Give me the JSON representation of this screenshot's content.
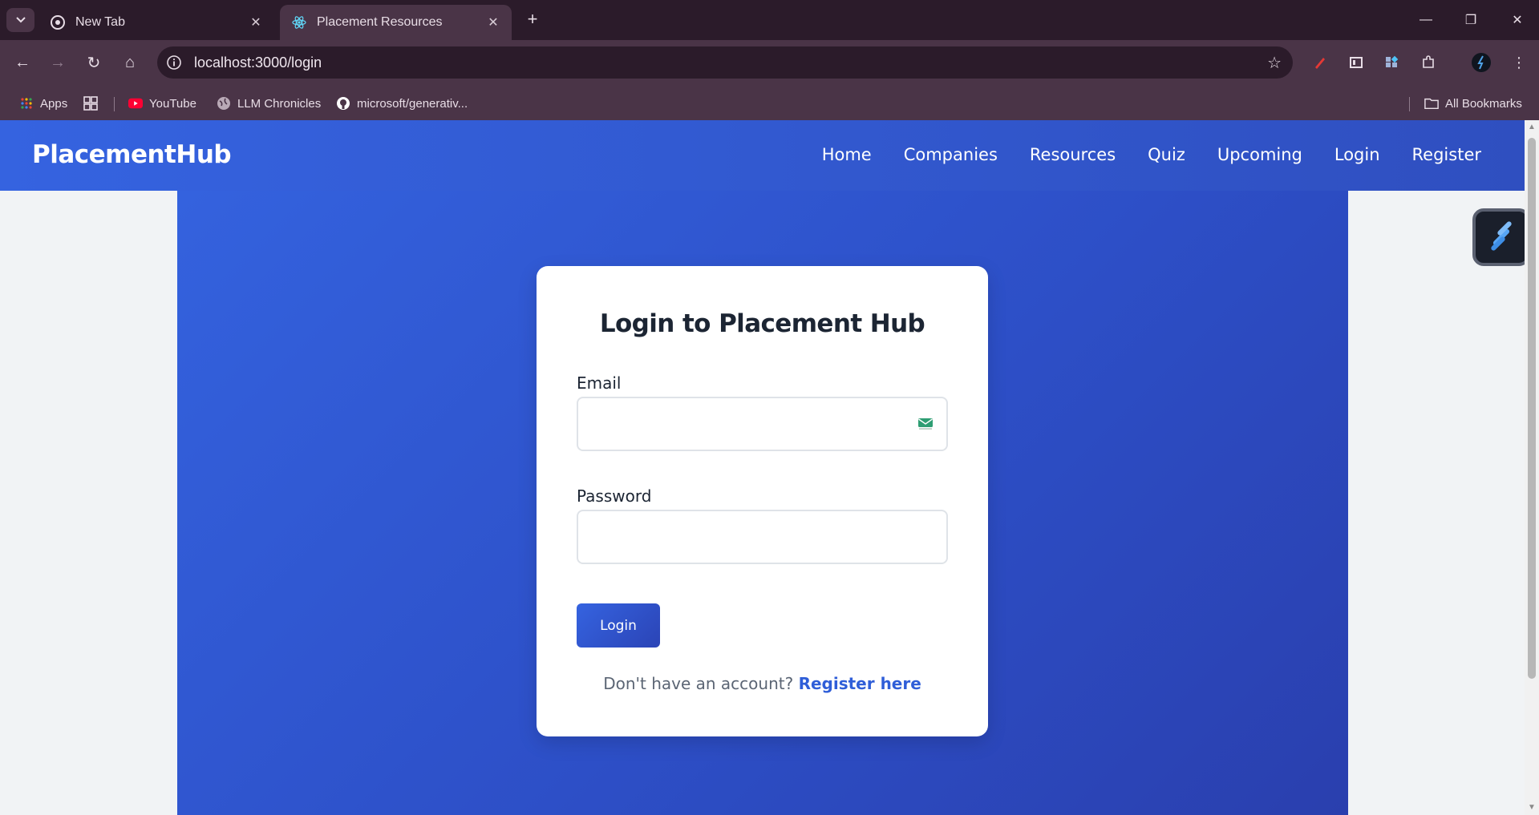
{
  "browser": {
    "tabs": [
      {
        "title": "New Tab",
        "active": false
      },
      {
        "title": "Placement Resources",
        "active": true
      }
    ],
    "url": "localhost:3000/login",
    "bookmarks": [
      {
        "label": "Apps"
      },
      {
        "label": "YouTube"
      },
      {
        "label": "LLM Chronicles"
      },
      {
        "label": "microsoft/generativ..."
      }
    ],
    "all_bookmarks_label": "All Bookmarks"
  },
  "site": {
    "brand": "PlacementHub",
    "nav": [
      "Home",
      "Companies",
      "Resources",
      "Quiz",
      "Upcoming",
      "Login",
      "Register"
    ]
  },
  "login": {
    "title": "Login to Placement Hub",
    "email_label": "Email",
    "email_value": "",
    "password_label": "Password",
    "password_value": "",
    "submit_label": "Login",
    "register_prompt": "Don't have an account?",
    "register_link": "Register here"
  },
  "colors": {
    "primary": "#3563e0",
    "primary_dark": "#2b44b6",
    "heading": "#1c2533",
    "link": "#2f5ed8"
  }
}
